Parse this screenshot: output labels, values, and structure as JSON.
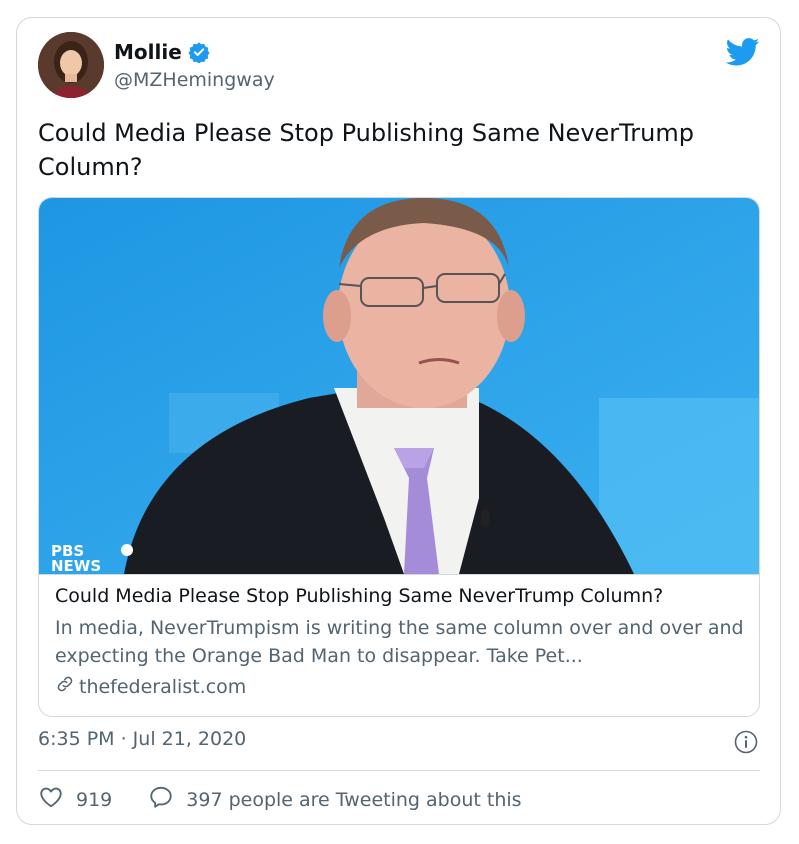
{
  "author": {
    "display_name": "Mollie",
    "handle": "@MZHemingway",
    "verified": true,
    "avatar": "avatar"
  },
  "tweet": {
    "text": "Could Media Please Stop Publishing Same NeverTrump Column?"
  },
  "link_card": {
    "image": "tv-news-guest-photo",
    "logo_text_top": "PBS",
    "logo_text_bottom": "NEWS",
    "title": "Could Media Please Stop Publishing Same NeverTrump Column?",
    "description": "In media, NeverTrumpism is writing the same column over and over and expecting the Orange Bad Man to disappear. Take Pet...",
    "domain": "thefederalist.com",
    "domain_icon": "link-icon"
  },
  "meta": {
    "timestamp": "6:35 PM · Jul 21, 2020",
    "info_icon": "info-icon"
  },
  "actions": {
    "likes": "919",
    "like_icon": "heart-icon",
    "conversation_icon": "reply-bubble-icon",
    "conversation_text": "397 people are Tweeting about this"
  },
  "colors": {
    "brand_blue": "#1d9bf0",
    "secondary_text": "#536471",
    "border": "#cfd9de"
  },
  "icons": {
    "platform": "twitter-bird-icon",
    "verified": "verified-badge-icon"
  }
}
